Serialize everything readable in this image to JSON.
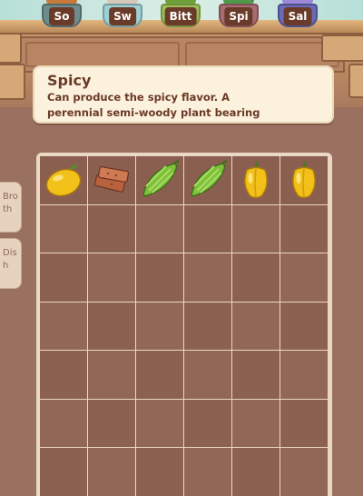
{
  "shelf": {
    "pots": [
      {
        "tag": "So",
        "body_color": "#6e8c8e",
        "plant_color": "#c87a3a"
      },
      {
        "tag": "Sw",
        "body_color": "#9fd0d6",
        "plant_color": "#d6c8b8"
      },
      {
        "tag": "Bitt",
        "body_color": "#9bbf55",
        "plant_color": "#6fa03a"
      },
      {
        "tag": "Spi",
        "body_color": "#a86b70",
        "plant_color": "#4f9a4a"
      },
      {
        "tag": "Sal",
        "body_color": "#6a6ab8",
        "plant_color": "#9b88d8"
      }
    ]
  },
  "tooltip": {
    "title": "Spicy",
    "description": "Can produce the spicy flavor. A\nperennial semi-woody plant bearing"
  },
  "side_tabs": [
    {
      "label": "Broth"
    },
    {
      "label": "Dish"
    }
  ],
  "inventory": {
    "columns": 6,
    "rows": 7,
    "items": [
      {
        "name": "lemon-icon"
      },
      {
        "name": "brick-icon"
      },
      {
        "name": "bitter-melon-icon"
      },
      {
        "name": "bitter-melon-icon"
      },
      {
        "name": "yellow-pepper-icon"
      },
      {
        "name": "yellow-pepper-icon"
      }
    ]
  },
  "colors": {
    "background": "#9a7060",
    "tooltip_bg": "#fbf1dc",
    "tooltip_text": "#6a3a28",
    "grid_cell": "#8d6151",
    "tag_bg": "#6b3b2a"
  }
}
